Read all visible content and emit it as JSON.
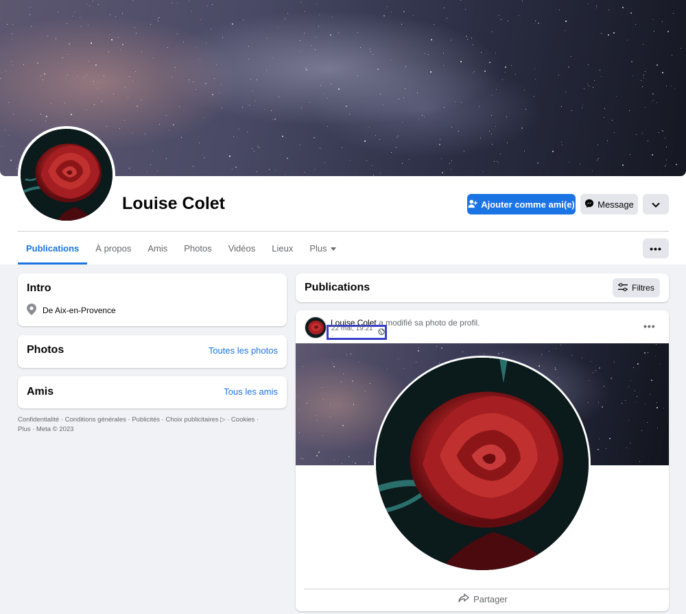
{
  "profile": {
    "name": "Louise Colet",
    "add_friend_label": "Ajouter comme ami(e)",
    "message_label": "Message"
  },
  "tabs": [
    {
      "label": "Publications",
      "active": true
    },
    {
      "label": "À propos"
    },
    {
      "label": "Amis"
    },
    {
      "label": "Photos"
    },
    {
      "label": "Vidéos"
    },
    {
      "label": "Lieux"
    },
    {
      "label": "Plus"
    }
  ],
  "intro": {
    "title": "Intro",
    "location": "De Aix-en-Provence"
  },
  "photos_card": {
    "title": "Photos",
    "link": "Toutes les photos"
  },
  "friends_card": {
    "title": "Amis",
    "link": "Tous les amis"
  },
  "footer": {
    "line1": "Confidentialité · Conditions générales · Publicités · Choix publicitaires ▷ · Cookies ·",
    "line2": "Plus · Meta © 2023"
  },
  "publications": {
    "title": "Publications",
    "filter_label": "Filtres"
  },
  "post": {
    "author": "Louise Colet",
    "action": "a modifié sa photo de profil.",
    "timestamp": "22 mai, 19:21 ·",
    "share_label": "Partager"
  },
  "colors": {
    "accent": "#1b74e4",
    "highlight_box": "#3a3fcb",
    "page_bg": "#f0f2f5"
  }
}
